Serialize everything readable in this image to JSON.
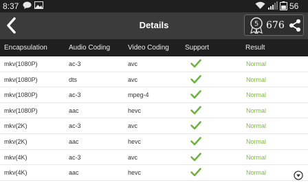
{
  "status_bar": {
    "time": "8:37",
    "battery": "56"
  },
  "app_bar": {
    "title": "Details",
    "medal_number": "5",
    "score": "676"
  },
  "table": {
    "headers": [
      "Encapsulation",
      "Audio Coding",
      "Video Coding",
      "Support",
      "Result"
    ],
    "rows": [
      {
        "encapsulation": "mkv(1080P)",
        "audio": "ac-3",
        "video": "avc",
        "result": "Normal"
      },
      {
        "encapsulation": "mkv(1080P)",
        "audio": "dts",
        "video": "avc",
        "result": "Normal"
      },
      {
        "encapsulation": "mkv(1080P)",
        "audio": "ac-3",
        "video": "mpeg-4",
        "result": "Normal"
      },
      {
        "encapsulation": "mkv(1080P)",
        "audio": "aac",
        "video": "hevc",
        "result": "Normal"
      },
      {
        "encapsulation": "mkv(2K)",
        "audio": "ac-3",
        "video": "avc",
        "result": "Normal"
      },
      {
        "encapsulation": "mkv(2K)",
        "audio": "aac",
        "video": "hevc",
        "result": "Normal"
      },
      {
        "encapsulation": "mkv(4K)",
        "audio": "ac-3",
        "video": "avc",
        "result": "Normal"
      },
      {
        "encapsulation": "mkv(4K)",
        "audio": "aac",
        "video": "hevc",
        "result": "Normal"
      }
    ]
  },
  "colors": {
    "check": "#6cb33f",
    "result": "#7dbb3a",
    "app_bar": "#3b3b3b"
  },
  "icons": {
    "status": [
      "chat-icon",
      "image-icon",
      "wifi-icon",
      "signal-icon",
      "battery-icon"
    ],
    "app_bar": [
      "back-arrow-icon",
      "medal-icon",
      "share-icon"
    ],
    "table": "checkmark-icon",
    "footer": "scroll-down-icon"
  }
}
